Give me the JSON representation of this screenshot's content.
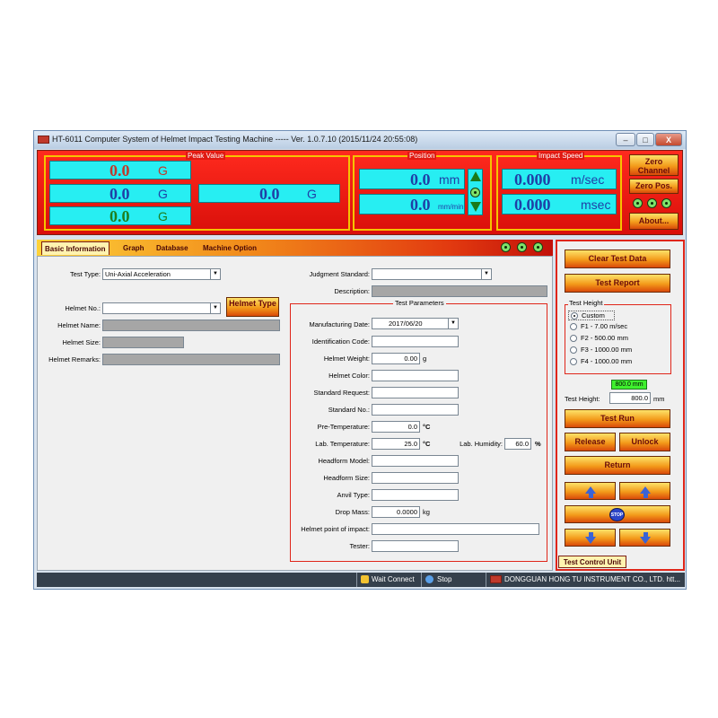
{
  "window": {
    "title": "HT-6011 Computer System of Helmet Impact Testing Machine ----- Ver. 1.0.7.10 (2015/11/24 20:55:08)",
    "min": "–",
    "max": "□",
    "close": "X"
  },
  "peak": {
    "label": "Peak Value",
    "rows": [
      {
        "value": "0.0",
        "unit": "G",
        "color": "#c0392b"
      },
      {
        "value": "0.0",
        "unit": "G",
        "color": "#1f3fa6"
      },
      {
        "value": "0.0",
        "unit": "G",
        "color": "#1e7e1e"
      }
    ],
    "total": {
      "value": "0.0",
      "unit": "G"
    }
  },
  "position": {
    "label": "Position",
    "value1": "0.0",
    "unit1": "mm",
    "value2": "0.0",
    "unit2": "mm/min"
  },
  "impact_speed": {
    "label": "Impact Speed",
    "value1": "0.000",
    "unit1": "m/sec",
    "value2": "0.000",
    "unit2": "msec"
  },
  "top_buttons": {
    "zero_channel": "Zero Channel",
    "zero_pos": "Zero Pos.",
    "about": "About..."
  },
  "tabs": [
    "Basic Information",
    "Graph",
    "Database",
    "Machine Option"
  ],
  "left_form": {
    "test_type_label": "Test Type:",
    "test_type_value": "Uni-Axial Acceleration",
    "helmet_no_label": "Helmet No.:",
    "helmet_no_value": "",
    "helmet_type_button": "Helmet Type",
    "helmet_name_label": "Helmet Name:",
    "helmet_size_label": "Helmet Size:",
    "helmet_remarks_label": "Helmet Remarks:"
  },
  "judgment": {
    "judgment_label": "Judgment Standard:",
    "judgment_value": "",
    "description_label": "Description:"
  },
  "test_params": {
    "label": "Test Parameters",
    "manufacturing_date_label": "Manufacturing Date:",
    "manufacturing_date_value": "2017/06/20",
    "identification_code_label": "Identification Code:",
    "helmet_weight_label": "Helmet Weight:",
    "helmet_weight_value": "0.00",
    "helmet_weight_unit": "g",
    "helmet_color_label": "Helmet Color:",
    "standard_request_label": "Standard Request:",
    "standard_no_label": "Standard No.:",
    "pre_temp_label": "Pre-Temperature:",
    "pre_temp_value": "0.0",
    "pre_temp_unit": "°C",
    "lab_temp_label": "Lab. Temperature:",
    "lab_temp_value": "25.0",
    "lab_temp_unit": "°C",
    "lab_humidity_label": "Lab. Humidity:",
    "lab_humidity_value": "60.0",
    "lab_humidity_unit": "%",
    "headform_model_label": "Headform Model:",
    "headform_size_label": "Headform Size:",
    "anvil_type_label": "Anvil Type:",
    "drop_mass_label": "Drop Mass:",
    "drop_mass_value": "0.0000",
    "drop_mass_unit": "kg",
    "impact_point_label": "Helmet point of impact:",
    "tester_label": "Tester:"
  },
  "control": {
    "clear": "Clear Test Data",
    "report": "Test Report",
    "height_group": "Test Height",
    "options": [
      "Custom",
      "F1 - 7.00 m/sec",
      "F2 - 500.00 mm",
      "F3 - 1000.00 mm",
      "F4 - 1000.00 mm"
    ],
    "selected": 0,
    "height_display": "800.0 mm",
    "height_label": "Test Height:",
    "height_value": "800.0",
    "height_unit": "mm",
    "run": "Test Run",
    "release": "Release",
    "unlock": "Unlock",
    "return": "Return",
    "stop": "STOP",
    "tab": "Test Control Unit"
  },
  "status": {
    "wait": "Wait Connect",
    "stop": "Stop",
    "company": "DONGGUAN HONG TU INSTRUMENT CO., LTD. htt..."
  }
}
